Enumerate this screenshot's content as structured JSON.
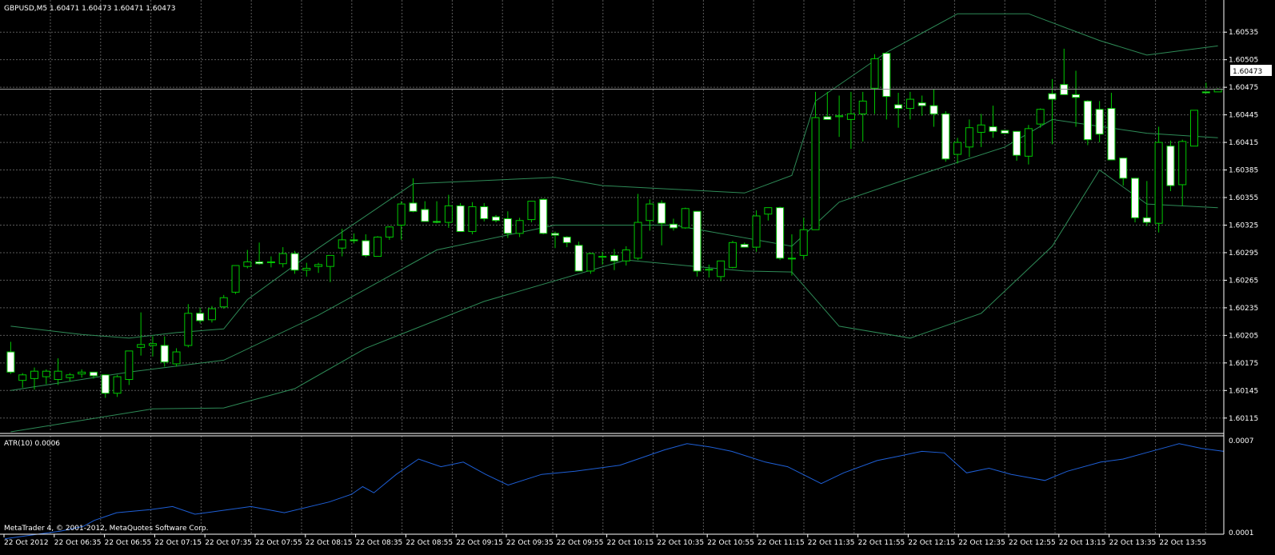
{
  "header": {
    "symbol_line": "GBPUSD,M5  1.60471 1.60473 1.60471 1.60473",
    "indicator_line": "ATR(10) 0.0006",
    "copyright": "MetaTrader 4, © 2001-2012, MetaQuotes Software Corp."
  },
  "colors": {
    "background": "#000000",
    "grid": "#5a5a5a",
    "bull_body": "#000000",
    "bear_body": "#ffffff",
    "wick": "#00c800",
    "bands": "#2e8b57",
    "atr": "#1e5fd6",
    "price_line": "#9a9a9a"
  },
  "current_price_label": "1.60473",
  "chart_data": [
    {
      "type": "candlestick",
      "title": "GBPUSD,M5",
      "ylim": [
        1.601,
        1.6057
      ],
      "price_ticks": [
        "1.60535",
        "1.60505",
        "1.60475",
        "1.60445",
        "1.60415",
        "1.60385",
        "1.60355",
        "1.60325",
        "1.60295",
        "1.60265",
        "1.60235",
        "1.60205",
        "1.60175",
        "1.60145",
        "1.60115"
      ],
      "time_ticks": [
        "22 Oct 2012",
        "22 Oct 06:35",
        "22 Oct 06:55",
        "22 Oct 07:15",
        "22 Oct 07:35",
        "22 Oct 07:55",
        "22 Oct 08:15",
        "22 Oct 08:35",
        "22 Oct 08:55",
        "22 Oct 09:15",
        "22 Oct 09:35",
        "22 Oct 09:55",
        "22 Oct 10:15",
        "22 Oct 10:35",
        "22 Oct 10:55",
        "22 Oct 11:15",
        "22 Oct 11:35",
        "22 Oct 11:55",
        "22 Oct 12:15",
        "22 Oct 12:35",
        "22 Oct 12:55",
        "22 Oct 13:15",
        "22 Oct 13:35",
        "22 Oct 13:55"
      ],
      "candles": [
        [
          1.60187,
          1.60198,
          1.60163,
          1.60165
        ],
        [
          1.60156,
          1.60164,
          1.60148,
          1.60162
        ],
        [
          1.60158,
          1.6017,
          1.60146,
          1.60166
        ],
        [
          1.6016,
          1.60168,
          1.60152,
          1.60166
        ],
        [
          1.60157,
          1.6018,
          1.60151,
          1.60166
        ],
        [
          1.60159,
          1.60164,
          1.60155,
          1.60162
        ],
        [
          1.60163,
          1.60168,
          1.60159,
          1.60165
        ],
        [
          1.60165,
          1.60165,
          1.60158,
          1.60161
        ],
        [
          1.60162,
          1.60162,
          1.60137,
          1.60142
        ],
        [
          1.60142,
          1.60162,
          1.60138,
          1.6016
        ],
        [
          1.60157,
          1.60187,
          1.60151,
          1.60188
        ],
        [
          1.60192,
          1.6023,
          1.60183,
          1.60195
        ],
        [
          1.60194,
          1.60204,
          1.60182,
          1.60196
        ],
        [
          1.60194,
          1.60204,
          1.60171,
          1.60176
        ],
        [
          1.60174,
          1.60191,
          1.60171,
          1.60187
        ],
        [
          1.60194,
          1.60239,
          1.60192,
          1.60229
        ],
        [
          1.60229,
          1.60235,
          1.60218,
          1.60221
        ],
        [
          1.60222,
          1.60237,
          1.60219,
          1.60234
        ],
        [
          1.60236,
          1.60249,
          1.60234,
          1.60246
        ],
        [
          1.60252,
          1.60281,
          1.6025,
          1.60281
        ],
        [
          1.6028,
          1.60298,
          1.60278,
          1.60285
        ],
        [
          1.60285,
          1.60306,
          1.60282,
          1.60283
        ],
        [
          1.60285,
          1.60291,
          1.60279,
          1.60285
        ],
        [
          1.60283,
          1.60301,
          1.60279,
          1.60294
        ],
        [
          1.60294,
          1.60297,
          1.60272,
          1.60276
        ],
        [
          1.60276,
          1.60284,
          1.60269,
          1.60278
        ],
        [
          1.6028,
          1.60284,
          1.60273,
          1.60282
        ],
        [
          1.6028,
          1.60288,
          1.60263,
          1.60292
        ],
        [
          1.603,
          1.60321,
          1.60291,
          1.60309
        ],
        [
          1.60309,
          1.60316,
          1.60305,
          1.60308
        ],
        [
          1.60308,
          1.60315,
          1.6029,
          1.60292
        ],
        [
          1.60291,
          1.60313,
          1.60291,
          1.60312
        ],
        [
          1.60312,
          1.60324,
          1.60309,
          1.60323
        ],
        [
          1.60325,
          1.60351,
          1.60309,
          1.60348
        ],
        [
          1.60349,
          1.60376,
          1.60339,
          1.6034
        ],
        [
          1.60342,
          1.60351,
          1.60331,
          1.60329
        ],
        [
          1.60329,
          1.60351,
          1.60327,
          1.60328
        ],
        [
          1.60328,
          1.60358,
          1.60322,
          1.60346
        ],
        [
          1.60346,
          1.60349,
          1.60319,
          1.60318
        ],
        [
          1.60318,
          1.6035,
          1.60315,
          1.60345
        ],
        [
          1.60345,
          1.60349,
          1.60329,
          1.60332
        ],
        [
          1.60334,
          1.60336,
          1.60328,
          1.6033
        ],
        [
          1.60332,
          1.6034,
          1.60311,
          1.60316
        ],
        [
          1.60316,
          1.60333,
          1.60312,
          1.6033
        ],
        [
          1.60331,
          1.60351,
          1.60328,
          1.60351
        ],
        [
          1.60353,
          1.60354,
          1.60315,
          1.60316
        ],
        [
          1.60316,
          1.60318,
          1.603,
          1.60314
        ],
        [
          1.60312,
          1.60313,
          1.60301,
          1.60306
        ],
        [
          1.60303,
          1.60307,
          1.60275,
          1.60275
        ],
        [
          1.60275,
          1.60295,
          1.60272,
          1.60294
        ],
        [
          1.6029,
          1.60296,
          1.60282,
          1.60291
        ],
        [
          1.60292,
          1.60299,
          1.60276,
          1.60286
        ],
        [
          1.60286,
          1.60302,
          1.60281,
          1.60298
        ],
        [
          1.60289,
          1.60359,
          1.60287,
          1.60328
        ],
        [
          1.6033,
          1.60353,
          1.60319,
          1.60348
        ],
        [
          1.60349,
          1.60352,
          1.60303,
          1.60327
        ],
        [
          1.60326,
          1.60332,
          1.60319,
          1.60322
        ],
        [
          1.60322,
          1.60344,
          1.60321,
          1.60343
        ],
        [
          1.6034,
          1.6034,
          1.60269,
          1.60275
        ],
        [
          1.60276,
          1.60282,
          1.60268,
          1.60277
        ],
        [
          1.60269,
          1.60285,
          1.60264,
          1.60286
        ],
        [
          1.60279,
          1.60308,
          1.60278,
          1.60306
        ],
        [
          1.60304,
          1.60306,
          1.60301,
          1.60301
        ],
        [
          1.60301,
          1.60341,
          1.60296,
          1.60335
        ],
        [
          1.60337,
          1.60343,
          1.6033,
          1.60344
        ],
        [
          1.60344,
          1.60345,
          1.60287,
          1.60289
        ],
        [
          1.60289,
          1.60315,
          1.6027,
          1.60289
        ],
        [
          1.60292,
          1.60333,
          1.60288,
          1.6032
        ],
        [
          1.6032,
          1.6047,
          1.60328,
          1.60442
        ],
        [
          1.60443,
          1.6047,
          1.60442,
          1.6044
        ],
        [
          1.60443,
          1.60466,
          1.60421,
          1.60444
        ],
        [
          1.6044,
          1.6047,
          1.60408,
          1.60446
        ],
        [
          1.60446,
          1.6047,
          1.60416,
          1.6046
        ],
        [
          1.60474,
          1.60511,
          1.60446,
          1.60506
        ],
        [
          1.60512,
          1.60513,
          1.6044,
          1.60465
        ],
        [
          1.60456,
          1.60469,
          1.60431,
          1.60452
        ],
        [
          1.60452,
          1.6047,
          1.6044,
          1.60462
        ],
        [
          1.60458,
          1.60466,
          1.60444,
          1.60455
        ],
        [
          1.60455,
          1.60473,
          1.60432,
          1.60446
        ],
        [
          1.60446,
          1.60449,
          1.60394,
          1.60397
        ],
        [
          1.60402,
          1.6042,
          1.60392,
          1.60415
        ],
        [
          1.6041,
          1.6044,
          1.60399,
          1.60431
        ],
        [
          1.60426,
          1.60446,
          1.6041,
          1.60434
        ],
        [
          1.60432,
          1.60455,
          1.6042,
          1.60427
        ],
        [
          1.60428,
          1.60428,
          1.60427,
          1.60425
        ],
        [
          1.60427,
          1.60427,
          1.60395,
          1.60401
        ],
        [
          1.604,
          1.60434,
          1.60391,
          1.6043
        ],
        [
          1.60435,
          1.60452,
          1.60431,
          1.60451
        ],
        [
          1.60468,
          1.60484,
          1.60413,
          1.60462
        ],
        [
          1.60478,
          1.60517,
          1.60468,
          1.60467
        ],
        [
          1.60467,
          1.60493,
          1.60432,
          1.60464
        ],
        [
          1.6046,
          1.60461,
          1.60412,
          1.60418
        ],
        [
          1.60451,
          1.6046,
          1.60415,
          1.60424
        ],
        [
          1.60452,
          1.60469,
          1.60413,
          1.60396
        ],
        [
          1.60398,
          1.60397,
          1.60368,
          1.60376
        ],
        [
          1.60376,
          1.60374,
          1.60328,
          1.60333
        ],
        [
          1.60333,
          1.60373,
          1.60324,
          1.60328
        ],
        [
          1.60327,
          1.60432,
          1.60317,
          1.60415
        ],
        [
          1.60411,
          1.60417,
          1.60362,
          1.60368
        ],
        [
          1.60369,
          1.60418,
          1.60346,
          1.60416
        ],
        [
          1.60411,
          1.60446,
          1.60411,
          1.6045
        ],
        [
          1.6047,
          1.6048,
          1.60474,
          1.60469
        ],
        [
          1.6047,
          1.60474,
          1.60471,
          1.60473
        ]
      ],
      "bands": {
        "upper": [
          [
            0,
            1.60215
          ],
          [
            6,
            1.60206
          ],
          [
            10,
            1.60202
          ],
          [
            14,
            1.60208
          ],
          [
            18,
            1.60212
          ],
          [
            20,
            1.60244
          ],
          [
            26,
            1.603
          ],
          [
            34,
            1.6037
          ],
          [
            46,
            1.60377
          ],
          [
            50,
            1.60368
          ],
          [
            62,
            1.6036
          ],
          [
            66,
            1.60379
          ],
          [
            68,
            1.6046
          ],
          [
            74,
            1.60513
          ],
          [
            80,
            1.60555
          ],
          [
            86,
            1.60555
          ],
          [
            92,
            1.60526
          ],
          [
            96,
            1.6051
          ],
          [
            102,
            1.6052
          ]
        ],
        "middle": [
          [
            0,
            1.60145
          ],
          [
            10,
            1.60165
          ],
          [
            18,
            1.60178
          ],
          [
            26,
            1.60227
          ],
          [
            36,
            1.60298
          ],
          [
            46,
            1.60325
          ],
          [
            56,
            1.60325
          ],
          [
            66,
            1.60302
          ],
          [
            70,
            1.6035
          ],
          [
            78,
            1.60385
          ],
          [
            84,
            1.6041
          ],
          [
            88,
            1.6044
          ],
          [
            96,
            1.60425
          ],
          [
            102,
            1.6042
          ]
        ],
        "lower": [
          [
            0,
            1.601
          ],
          [
            12,
            1.60125
          ],
          [
            18,
            1.60126
          ],
          [
            24,
            1.60147
          ],
          [
            30,
            1.60191
          ],
          [
            40,
            1.60242
          ],
          [
            52,
            1.60287
          ],
          [
            62,
            1.60275
          ],
          [
            66,
            1.60274
          ],
          [
            70,
            1.60215
          ],
          [
            76,
            1.60202
          ],
          [
            82,
            1.60229
          ],
          [
            88,
            1.60302
          ],
          [
            92,
            1.60385
          ],
          [
            96,
            1.60348
          ],
          [
            102,
            1.60344
          ]
        ]
      }
    },
    {
      "type": "line",
      "title": "ATR(10) 0.0006",
      "ylim": [
        0.0001,
        0.0007
      ],
      "ticks": [
        "0.0007",
        "0.0001"
      ],
      "values": [
        [
          0,
          6e-05
        ],
        [
          6,
          9e-05
        ],
        [
          10,
          0.00011
        ],
        [
          14,
          0.00014
        ],
        [
          16,
          0.00018
        ],
        [
          20,
          0.00023
        ],
        [
          26,
          0.00025
        ],
        [
          30,
          0.00027
        ],
        [
          34,
          0.00022
        ],
        [
          40,
          0.00025
        ],
        [
          44,
          0.00027
        ],
        [
          50,
          0.00023
        ],
        [
          58,
          0.0003
        ],
        [
          62,
          0.00035
        ],
        [
          64,
          0.0004
        ],
        [
          66,
          0.00036
        ],
        [
          70,
          0.00048
        ],
        [
          74,
          0.00058
        ],
        [
          78,
          0.00053
        ],
        [
          82,
          0.00056
        ],
        [
          86,
          0.00048
        ],
        [
          90,
          0.00041
        ],
        [
          96,
          0.00048
        ],
        [
          102,
          0.0005
        ],
        [
          110,
          0.00054
        ],
        [
          118,
          0.00064
        ],
        [
          122,
          0.00068
        ],
        [
          126,
          0.00066
        ],
        [
          130,
          0.00063
        ],
        [
          136,
          0.00056
        ],
        [
          140,
          0.00053
        ],
        [
          146,
          0.00042
        ],
        [
          150,
          0.00049
        ],
        [
          156,
          0.00057
        ],
        [
          160,
          0.0006
        ],
        [
          164,
          0.00063
        ],
        [
          168,
          0.00062
        ],
        [
          172,
          0.00049
        ],
        [
          176,
          0.00052
        ],
        [
          180,
          0.00048
        ],
        [
          186,
          0.00044
        ],
        [
          190,
          0.0005
        ],
        [
          196,
          0.00056
        ],
        [
          200,
          0.00058
        ],
        [
          204,
          0.00062
        ],
        [
          208,
          0.00066
        ],
        [
          210,
          0.00068
        ],
        [
          214,
          0.00065
        ],
        [
          218,
          0.00063
        ]
      ]
    }
  ]
}
